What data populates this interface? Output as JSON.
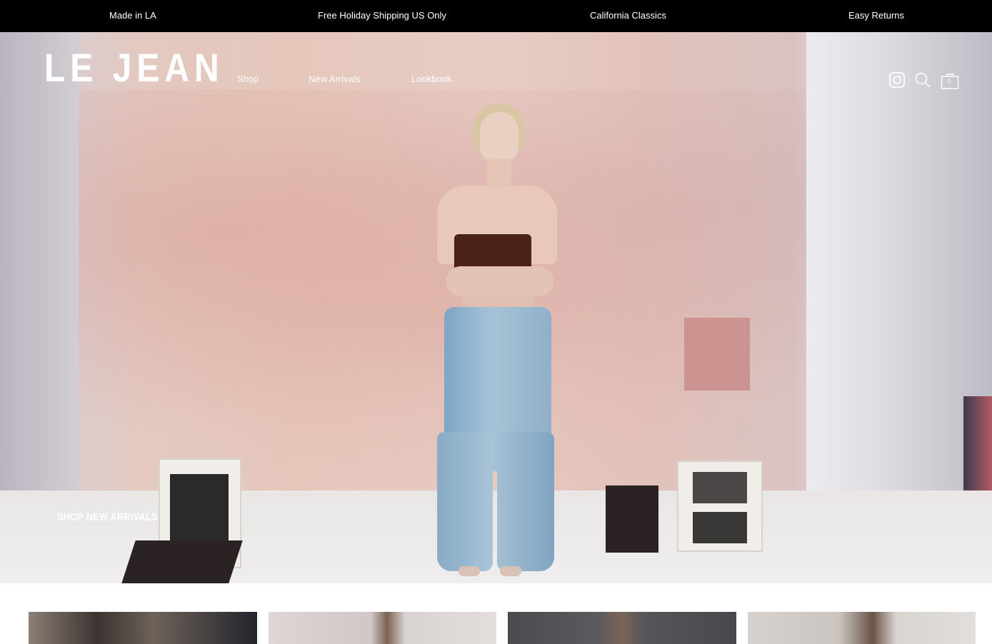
{
  "announcement_bar": {
    "items": [
      "Made in LA",
      "Free Holiday Shipping US Only",
      "California Classics",
      "Easy Returns"
    ]
  },
  "header": {
    "logo": "LE JEAN",
    "nav": [
      "Shop",
      "New Arrivals",
      "Lookbook"
    ],
    "icons": [
      "instagram-icon",
      "search-icon",
      "cart-icon"
    ],
    "cart_count": "0"
  },
  "hero": {
    "cta": "SHOP NEW ARRIVALS"
  },
  "product_tiles": {
    "count": 4
  }
}
